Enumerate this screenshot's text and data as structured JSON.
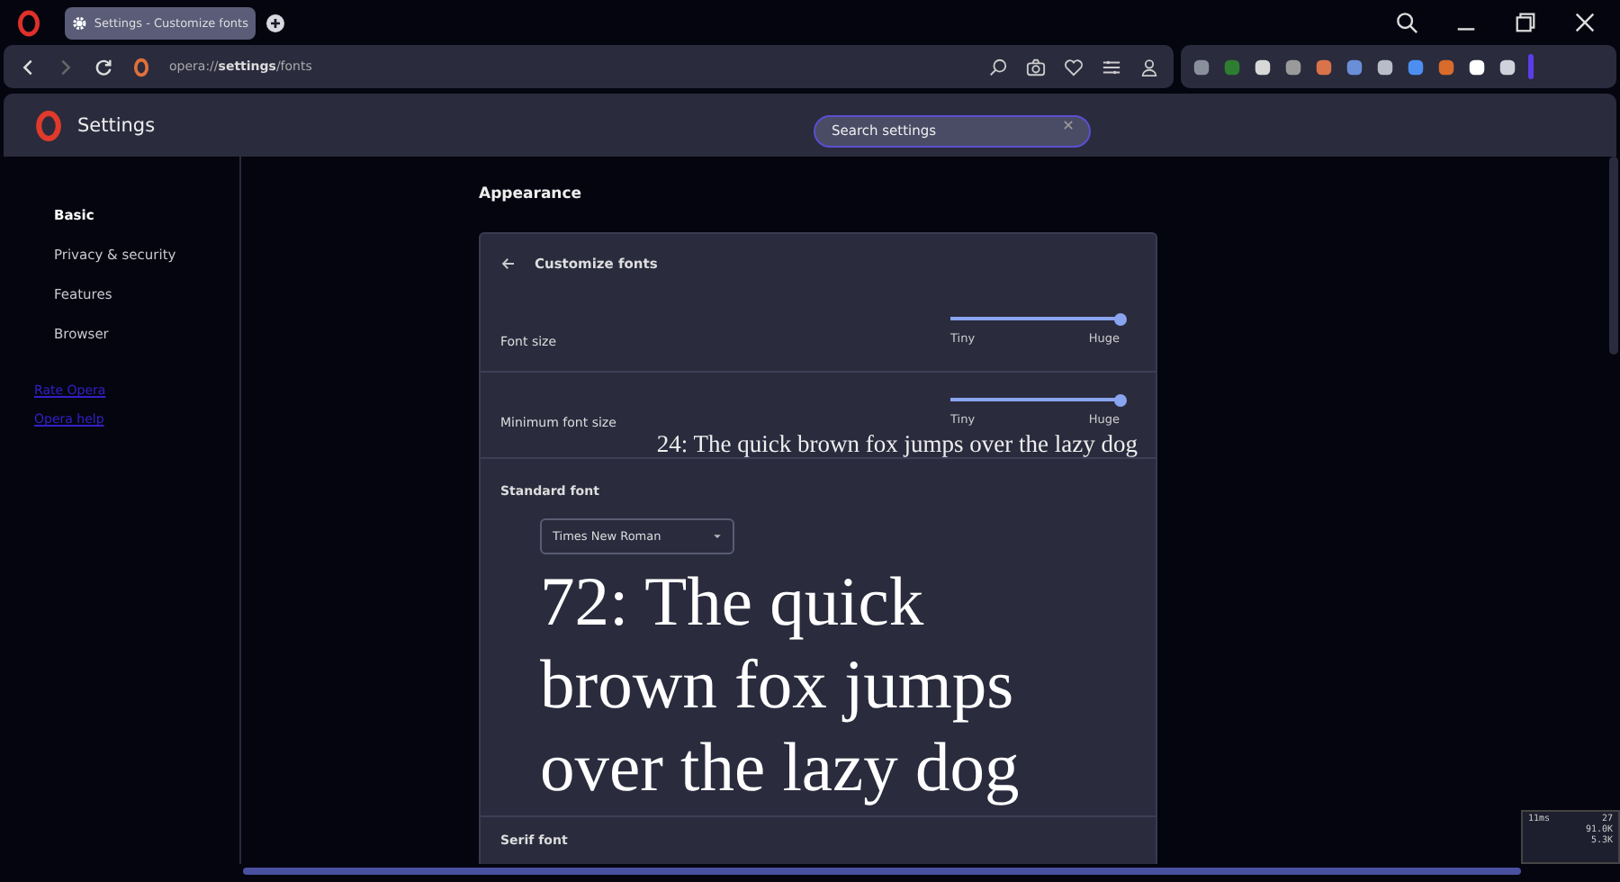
{
  "tab": {
    "title": "Settings - Customize fonts",
    "selected": true
  },
  "address": {
    "prefix": "opera://",
    "bold": "settings",
    "suffix": "/fonts"
  },
  "header": {
    "title": "Settings",
    "search": {
      "placeholder": "Search settings"
    }
  },
  "sidebar": {
    "items": [
      {
        "label": "Basic",
        "selected": true
      },
      {
        "label": "Privacy & security",
        "selected": false
      },
      {
        "label": "Features",
        "selected": false
      },
      {
        "label": "Browser",
        "selected": false
      }
    ],
    "links": [
      "Rate Opera",
      "Opera help"
    ]
  },
  "section_title": "Appearance",
  "card": {
    "title": "Customize fonts",
    "sliders": [
      {
        "label": "Font size",
        "level": 1,
        "min_label": "Tiny",
        "max_label": "Huge"
      },
      {
        "label": "Minimum font size",
        "level": 1,
        "min_label": "Tiny",
        "max_label": "Huge",
        "preview": "24: The quick brown fox jumps over the lazy dog"
      }
    ],
    "standard_font": {
      "label": "Standard font",
      "value": "Times New Roman",
      "preview": "72: The quick brown fox jumps over the lazy dog"
    },
    "next_section": "Serif font"
  },
  "meter": {
    "ping": "11ms",
    "count": "27",
    "down": "91.0K",
    "up": "5.3K"
  }
}
